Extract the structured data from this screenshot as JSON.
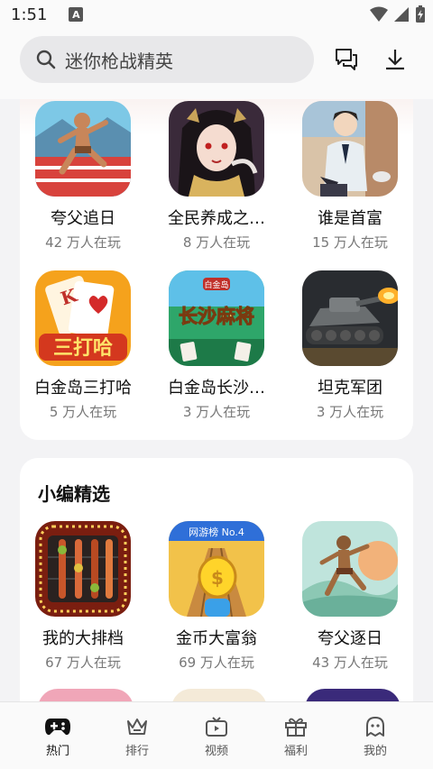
{
  "status": {
    "time": "1:51",
    "indicator": "A"
  },
  "search": {
    "placeholder": "迷你枪战精英"
  },
  "top_icons": [
    "chat-icon",
    "download-icon"
  ],
  "section1": {
    "games": [
      {
        "name": "夸父追日",
        "players": "42 万人在玩"
      },
      {
        "name": "全民养成之…",
        "players": "8 万人在玩"
      },
      {
        "name": "谁是首富",
        "players": "15 万人在玩"
      },
      {
        "name": "白金岛三打哈",
        "players": "5 万人在玩"
      },
      {
        "name": "白金岛长沙…",
        "players": "3 万人在玩"
      },
      {
        "name": "坦克军团",
        "players": "3 万人在玩"
      }
    ]
  },
  "section2": {
    "title": "小编精选",
    "games": [
      {
        "name": "我的大排档",
        "players": "67 万人在玩"
      },
      {
        "name": "金币大富翁",
        "players": "69 万人在玩",
        "badge": "网游榜 No.4"
      },
      {
        "name": "夸父逐日",
        "players": "43 万人在玩"
      }
    ]
  },
  "icon_text": {
    "sandahä": "三打哈",
    "changsha": "长沙麻将",
    "baijindao": "白金岛",
    "card_k": "K"
  },
  "nav": [
    {
      "label": "热门",
      "icon": "gamepad-icon",
      "active": true
    },
    {
      "label": "排行",
      "icon": "crown-icon"
    },
    {
      "label": "视频",
      "icon": "tv-icon"
    },
    {
      "label": "福利",
      "icon": "gift-icon"
    },
    {
      "label": "我的",
      "icon": "ghost-icon"
    }
  ]
}
